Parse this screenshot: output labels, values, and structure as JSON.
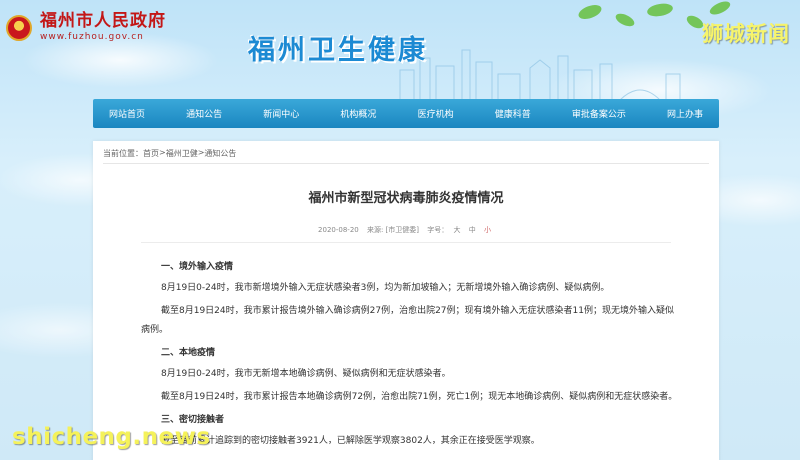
{
  "logo": {
    "name": "福州市人民政府",
    "url": "www.fuzhou.gov.cn"
  },
  "site_title": "福州卫生健康",
  "watermark_top": "狮城新闻",
  "nav": [
    "网站首页",
    "通知公告",
    "新闻中心",
    "机构概况",
    "医疗机构",
    "健康科普",
    "审批备案公示",
    "网上办事"
  ],
  "breadcrumb": {
    "prefix": "当前位置：",
    "items": [
      "首页",
      "福州卫健",
      "通知公告"
    ],
    "sep": ">"
  },
  "article": {
    "title": "福州市新型冠状病毒肺炎疫情情况",
    "date": "2020-08-20",
    "source": "来源: [市卫健委]",
    "font_label": "字号：",
    "font_sizes": [
      "大",
      "中",
      "小"
    ],
    "sections": [
      {
        "type": "h",
        "text": "一、境外输入疫情"
      },
      {
        "type": "p",
        "text": "8月19日0-24时，我市新增境外输入无症状感染者3例，均为新加坡输入；无新增境外输入确诊病例、疑似病例。"
      },
      {
        "type": "p",
        "text": "截至8月19日24时，我市累计报告境外输入确诊病例27例，治愈出院27例；现有境外输入无症状感染者11例；现无境外输入疑似病例。"
      },
      {
        "type": "h",
        "text": "二、本地疫情"
      },
      {
        "type": "p",
        "text": "8月19日0-24时，我市无新增本地确诊病例、疑似病例和无症状感染者。"
      },
      {
        "type": "p",
        "text": "截至8月19日24时，我市累计报告本地确诊病例72例，治愈出院71例，死亡1例；现无本地确诊病例、疑似病例和无症状感染者。"
      },
      {
        "type": "h",
        "text": "三、密切接触者"
      },
      {
        "type": "p",
        "text": "截至目前累计追踪到的密切接触者3921人，已解除医学观察3802人，其余正在接受医学观察。"
      }
    ]
  },
  "watermark_bottom": "shicheng.news",
  "colors": {
    "nav_bg": "#1a86c0",
    "title_blue": "#1c8ad3",
    "logo_red": "#c31717",
    "watermark": "#f5f25a"
  }
}
